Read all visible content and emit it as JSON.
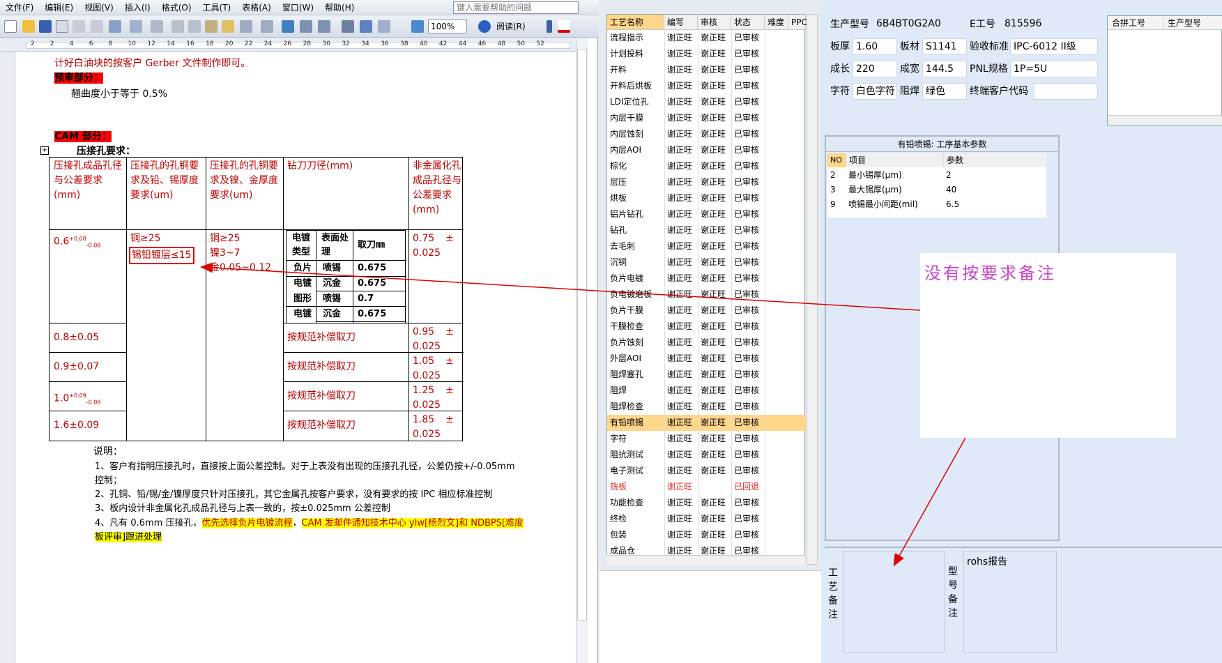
{
  "menu": [
    "文件(F)",
    "编辑(E)",
    "视图(V)",
    "插入(I)",
    "格式(O)",
    "工具(T)",
    "表格(A)",
    "窗口(W)",
    "帮助(H)"
  ],
  "help_placeholder": "键入需要帮助的问题",
  "zoom": "100%",
  "read_label": "阅读(R)",
  "ruler_ticks": [
    "2",
    "2",
    "4",
    "6",
    "8",
    "10",
    "12",
    "14",
    "16",
    "18",
    "20",
    "22",
    "24",
    "26",
    "28",
    "30",
    "32",
    "34",
    "36",
    "38",
    "40",
    "42",
    "44",
    "46",
    "48",
    "50",
    "52"
  ],
  "doc": {
    "line1": "计好白油块的按客户 Gerber 文件制作即可。",
    "review_head": "预审部分：",
    "warp": "翘曲度小于等于 0.5%",
    "cam_head": "CAM 部分：",
    "press_title": "压接孔要求：",
    "headers": [
      "压接孔成品孔径与公差要求(mm)",
      "压接孔的孔铜要求及铅、锡厚度要求(um)",
      "压接孔的孔铜要求及镍、金厚度要求(um)",
      "钻刀刀径(mm)",
      "非金属化孔成品孔径与公差要求(mm)"
    ],
    "row1": {
      "size": "0.6",
      "sup": "+0.08",
      "sub": "-0.08",
      "cu1": "铜≥25",
      "pb": "锡铅镀层≤15",
      "cu2": "铜≥25",
      "ni": "镍3~7",
      "au": "金0.05~0.12",
      "nm1": "0.75",
      "nm_pm": "±",
      "nm2": "0.025"
    },
    "inner": {
      "h1": "电镀类型",
      "h2": "表面处理",
      "h3": "取刀㎜",
      "rows": [
        [
          "负片",
          "喷锡",
          "0.675"
        ],
        [
          "电镀",
          "沉金",
          "0.675"
        ],
        [
          "图形",
          "喷锡",
          "0.7"
        ],
        [
          "电镀",
          "沉金",
          "0.675"
        ]
      ]
    },
    "rows": [
      {
        "size": "0.8±0.05",
        "drill": "按规范补偿取刀",
        "nm1": "0.95",
        "nm2": "0.025"
      },
      {
        "size": "0.9±0.07",
        "drill": "按规范补偿取刀",
        "nm1": "1.05",
        "nm2": "0.025"
      },
      {
        "size": "1.0",
        "sup": "+0.09",
        "sub": "-0.08",
        "drill": "按规范补偿取刀",
        "nm1": "1.25",
        "nm2": "0.025"
      },
      {
        "size": "1.6±0.09",
        "drill": "按规范补偿取刀",
        "nm1": "1.85",
        "nm2": "0.025"
      }
    ],
    "notes_title": "说明：",
    "note1": "1、客户有指明压接孔时，直接按上面公差控制。对于上表没有出现的压接孔孔径，公差仍按+/-0.05mm",
    "note1b": "控制；",
    "note2": "2、孔铜、铅/锡/金/镍厚度只针对压接孔，其它金属孔按客户要求，没有要求的按 IPC 相应标准控制",
    "note3": "3、板内设计非金属化孔成品孔径与上表一致的，按±0.025mm 公差控制",
    "note4a": "4、凡有 0.6mm 压接孔，",
    "note4b": "优先选择负片电镀流程",
    "note4c": "，",
    "note4d": "CAM 发邮件通知技术中心 ylw[杨烈文]和 NDBPS[难度",
    "note4e": "板评审]跟进处理"
  },
  "process": {
    "headers": [
      "工艺名称",
      "编写",
      "审核",
      "状态",
      "难度",
      "PPC"
    ],
    "rows": [
      [
        "流程指示",
        "谢正旺",
        "谢正旺",
        "已审核"
      ],
      [
        "计划投料",
        "谢正旺",
        "谢正旺",
        "已审核"
      ],
      [
        "开料",
        "谢正旺",
        "谢正旺",
        "已审核"
      ],
      [
        "开料后烘板",
        "谢正旺",
        "谢正旺",
        "已审核"
      ],
      [
        "LDI定位孔",
        "谢正旺",
        "谢正旺",
        "已审核"
      ],
      [
        "内层干膜",
        "谢正旺",
        "谢正旺",
        "已审核"
      ],
      [
        "内层蚀刻",
        "谢正旺",
        "谢正旺",
        "已审核"
      ],
      [
        "内层AOI",
        "谢正旺",
        "谢正旺",
        "已审核"
      ],
      [
        "棕化",
        "谢正旺",
        "谢正旺",
        "已审核"
      ],
      [
        "层压",
        "谢正旺",
        "谢正旺",
        "已审核"
      ],
      [
        "烘板",
        "谢正旺",
        "谢正旺",
        "已审核"
      ],
      [
        "铝片钻孔",
        "谢正旺",
        "谢正旺",
        "已审核"
      ],
      [
        "钻孔",
        "谢正旺",
        "谢正旺",
        "已审核"
      ],
      [
        "去毛刺",
        "谢正旺",
        "谢正旺",
        "已审核"
      ],
      [
        "沉铜",
        "谢正旺",
        "谢正旺",
        "已审核"
      ],
      [
        "负片电镀",
        "谢正旺",
        "谢正旺",
        "已审核"
      ],
      [
        "负电镀磨板",
        "谢正旺",
        "谢正旺",
        "已审核"
      ],
      [
        "负片干膜",
        "谢正旺",
        "谢正旺",
        "已审核"
      ],
      [
        "干膜检查",
        "谢正旺",
        "谢正旺",
        "已审核"
      ],
      [
        "负片蚀刻",
        "谢正旺",
        "谢正旺",
        "已审核"
      ],
      [
        "外层AOI",
        "谢正旺",
        "谢正旺",
        "已审核"
      ],
      [
        "阻焊塞孔",
        "谢正旺",
        "谢正旺",
        "已审核"
      ],
      [
        "阻焊",
        "谢正旺",
        "谢正旺",
        "已审核"
      ],
      [
        "阻焊检查",
        "谢正旺",
        "谢正旺",
        "已审核"
      ],
      [
        "有铅喷锡",
        "谢正旺",
        "谢正旺",
        "已审核"
      ],
      [
        "字符",
        "谢正旺",
        "谢正旺",
        "已审核"
      ],
      [
        "阻抗测试",
        "谢正旺",
        "谢正旺",
        "已审核"
      ],
      [
        "电子测试",
        "谢正旺",
        "谢正旺",
        "已审核"
      ],
      [
        "铣板",
        "谢正旺",
        "",
        "已回退"
      ],
      [
        "功能检查",
        "谢正旺",
        "谢正旺",
        "已审核"
      ],
      [
        "终检",
        "谢正旺",
        "谢正旺",
        "已审核"
      ],
      [
        "包装",
        "谢正旺",
        "谢正旺",
        "已审核"
      ],
      [
        "成品仓",
        "谢正旺",
        "谢正旺",
        "已审核"
      ]
    ]
  },
  "info": {
    "model_label": "生产型号",
    "model": "6B4BT0G2A0",
    "eno_label": "E工号",
    "eno": "815596",
    "thick_label": "板厚",
    "thick": "1.60",
    "mat_label": "板材",
    "mat": "S1141",
    "std_label": "验收标准",
    "std": "IPC-6012 II级",
    "len_label": "成长",
    "len": "220",
    "wid_label": "成宽",
    "wid": "144.5",
    "pnl_label": "PNL规格",
    "pnl": "1P=5U",
    "char_label": "字符",
    "char": "白色字符",
    "mask_label": "阻焊",
    "mask": "绿色",
    "cust_label": "终端客户代码",
    "merge_h1": "合拼工号",
    "merge_h2": "生产型号"
  },
  "params": {
    "title": "有铅喷锡: 工序基本参数",
    "h_no": "NO",
    "h_item": "项目",
    "h_val": "参数",
    "rows": [
      [
        "2",
        "最小锡厚(μm)",
        "2"
      ],
      [
        "3",
        "最大锡厚(μm)",
        "40"
      ],
      [
        "9",
        "喷锡最小间距(mil)",
        "6.5"
      ]
    ]
  },
  "notes": {
    "proc_label": "工艺备注",
    "model_label": "型号备注",
    "rohs": "rohs报告"
  },
  "annotation": "没有按要求备注",
  "colors": {
    "accent_red": "#c00000",
    "arrow": "#e00000",
    "selected": "#ffd68a",
    "annotation": "#cc44cc"
  }
}
